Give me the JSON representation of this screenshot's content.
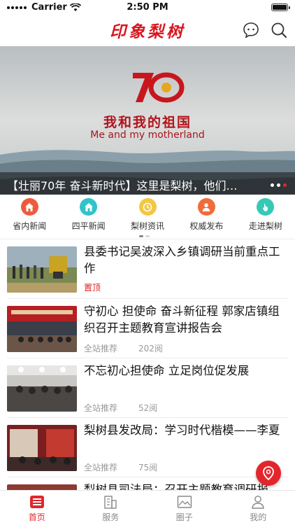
{
  "status_bar": {
    "carrier": "Carrier",
    "time": "2:50 PM"
  },
  "header": {
    "logo_text": "印象梨树",
    "icons": [
      "chat-icon",
      "search-icon"
    ]
  },
  "banner": {
    "emblem_text": "70",
    "slogan_cn": "我和我的祖国",
    "slogan_en": "Me and my motherland",
    "caption": "【壮丽70年 奋斗新时代】这里是梨树，他们…",
    "dots": 3,
    "active_dot": 2
  },
  "categories": [
    {
      "label": "省内新闻",
      "color": "#f05a3c"
    },
    {
      "label": "四平新闻",
      "color": "#2fc4c9"
    },
    {
      "label": "梨树资讯",
      "color": "#f4c742"
    },
    {
      "label": "权威发布",
      "color": "#f06b3a"
    },
    {
      "label": "走进梨树",
      "color": "#35c9b6"
    }
  ],
  "news": [
    {
      "title": "县委书记吴波深入乡镇调研当前重点工作",
      "tag": "置顶",
      "views": ""
    },
    {
      "title": "守初心 担使命 奋斗新征程 郭家店镇组织召开主题教育宣讲报告会",
      "tag": "全站推荐",
      "views": "202阅"
    },
    {
      "title": "不忘初心担使命 立足岗位促发展",
      "tag": "全站推荐",
      "views": "52阅"
    },
    {
      "title": "梨树县发改局：学习时代楷模——李夏",
      "tag": "全站推荐",
      "views": "75阅"
    },
    {
      "title": "梨树县司法局：召开主题教育调研报",
      "tag": "",
      "views": ""
    }
  ],
  "tabs": [
    {
      "label": "首页",
      "active": true
    },
    {
      "label": "服务",
      "active": false
    },
    {
      "label": "圈子",
      "active": false
    },
    {
      "label": "我的",
      "active": false
    }
  ],
  "colors": {
    "accent": "#e3262b",
    "logo": "#d8161f"
  }
}
